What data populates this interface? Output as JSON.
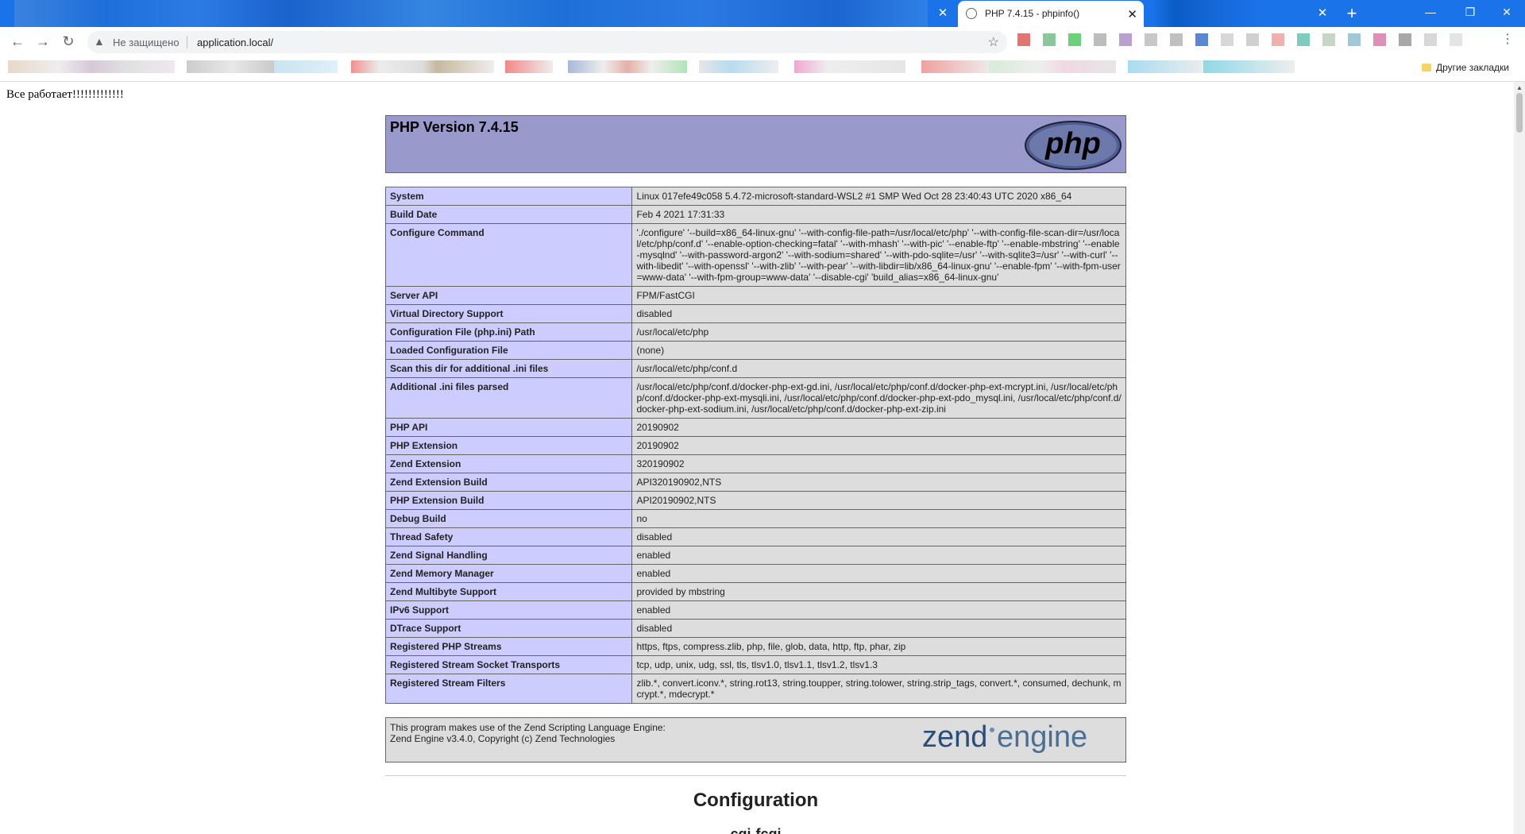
{
  "browser": {
    "active_tab_title": "PHP 7.4.15 - phpinfo()",
    "tab_close": "✕",
    "new_tab": "+",
    "security_label": "Не защищено",
    "url": "application.local/",
    "other_bookmarks": "Другие закладки"
  },
  "page": {
    "top_message": "Все работает!!!!!!!!!!!!!",
    "php_version": "PHP Version 7.4.15",
    "logo_text": "php",
    "rows": [
      {
        "label": "System",
        "value": "Linux 017efe49c058 5.4.72-microsoft-standard-WSL2 #1 SMP Wed Oct 28 23:40:43 UTC 2020 x86_64"
      },
      {
        "label": "Build Date",
        "value": "Feb 4 2021 17:31:33"
      },
      {
        "label": "Configure Command",
        "value": "'./configure' '--build=x86_64-linux-gnu' '--with-config-file-path=/usr/local/etc/php' '--with-config-file-scan-dir=/usr/local/etc/php/conf.d' '--enable-option-checking=fatal' '--with-mhash' '--with-pic' '--enable-ftp' '--enable-mbstring' '--enable-mysqlnd' '--with-password-argon2' '--with-sodium=shared' '--with-pdo-sqlite=/usr' '--with-sqlite3=/usr' '--with-curl' '--with-libedit' '--with-openssl' '--with-zlib' '--with-pear' '--with-libdir=lib/x86_64-linux-gnu' '--enable-fpm' '--with-fpm-user=www-data' '--with-fpm-group=www-data' '--disable-cgi' 'build_alias=x86_64-linux-gnu'"
      },
      {
        "label": "Server API",
        "value": "FPM/FastCGI"
      },
      {
        "label": "Virtual Directory Support",
        "value": "disabled"
      },
      {
        "label": "Configuration File (php.ini) Path",
        "value": "/usr/local/etc/php"
      },
      {
        "label": "Loaded Configuration File",
        "value": "(none)"
      },
      {
        "label": "Scan this dir for additional .ini files",
        "value": "/usr/local/etc/php/conf.d"
      },
      {
        "label": "Additional .ini files parsed",
        "value": "/usr/local/etc/php/conf.d/docker-php-ext-gd.ini, /usr/local/etc/php/conf.d/docker-php-ext-mcrypt.ini, /usr/local/etc/php/conf.d/docker-php-ext-mysqli.ini, /usr/local/etc/php/conf.d/docker-php-ext-pdo_mysql.ini, /usr/local/etc/php/conf.d/docker-php-ext-sodium.ini, /usr/local/etc/php/conf.d/docker-php-ext-zip.ini"
      },
      {
        "label": "PHP API",
        "value": "20190902"
      },
      {
        "label": "PHP Extension",
        "value": "20190902"
      },
      {
        "label": "Zend Extension",
        "value": "320190902"
      },
      {
        "label": "Zend Extension Build",
        "value": "API320190902,NTS"
      },
      {
        "label": "PHP Extension Build",
        "value": "API20190902,NTS"
      },
      {
        "label": "Debug Build",
        "value": "no"
      },
      {
        "label": "Thread Safety",
        "value": "disabled"
      },
      {
        "label": "Zend Signal Handling",
        "value": "enabled"
      },
      {
        "label": "Zend Memory Manager",
        "value": "enabled"
      },
      {
        "label": "Zend Multibyte Support",
        "value": "provided by mbstring"
      },
      {
        "label": "IPv6 Support",
        "value": "enabled"
      },
      {
        "label": "DTrace Support",
        "value": "disabled"
      },
      {
        "label": "Registered PHP Streams",
        "value": "https, ftps, compress.zlib, php, file, glob, data, http, ftp, phar, zip"
      },
      {
        "label": "Registered Stream Socket Transports",
        "value": "tcp, udp, unix, udg, ssl, tls, tlsv1.0, tlsv1.1, tlsv1.2, tlsv1.3"
      },
      {
        "label": "Registered Stream Filters",
        "value": "zlib.*, convert.iconv.*, string.rot13, string.toupper, string.tolower, string.strip_tags, convert.*, consumed, dechunk, mcrypt.*, mdecrypt.*"
      }
    ],
    "zend_line1": "This program makes use of the Zend Scripting Language Engine:",
    "zend_line2": "Zend Engine v3.4.0, Copyright (c) Zend Technologies",
    "zend_logo_word1": "zend",
    "zend_logo_word2": "engine",
    "section_heading": "Configuration",
    "subsection_heading": "cgi-fcgi"
  },
  "colors": {
    "tabstrip": "#1a73e8",
    "php_header": "#9999cc",
    "label_cell": "#ccccff",
    "value_cell": "#dddddd"
  }
}
